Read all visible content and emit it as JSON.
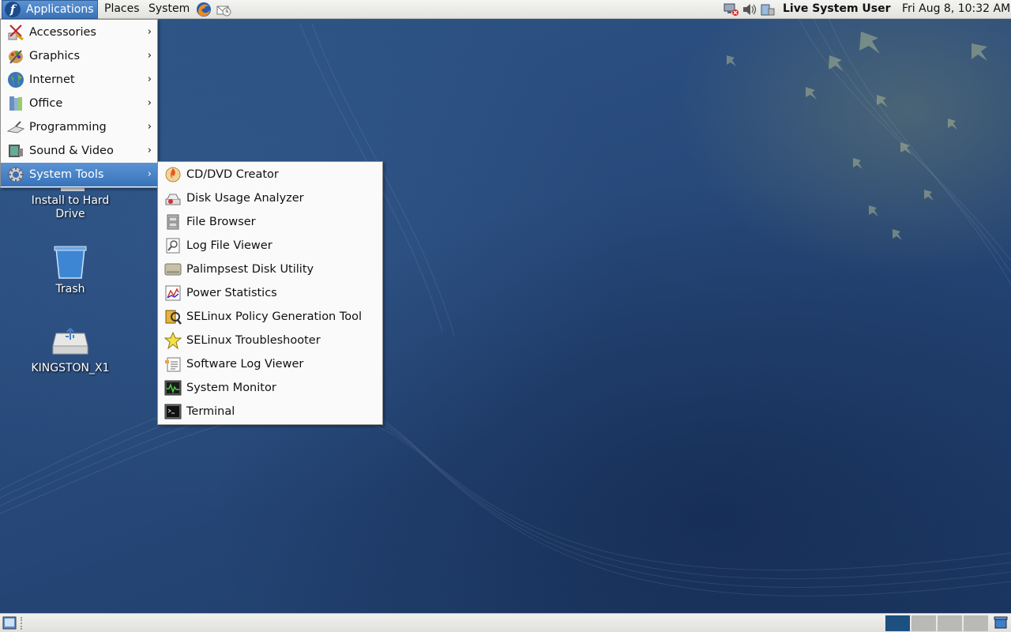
{
  "top_panel": {
    "applications": "Applications",
    "places": "Places",
    "system": "System",
    "user": "Live System User",
    "clock": "Fri Aug  8, 10:32 AM",
    "logo_letter": "f"
  },
  "applications_menu": {
    "items": [
      {
        "label": "Accessories",
        "icon": "accessories-icon"
      },
      {
        "label": "Graphics",
        "icon": "graphics-icon"
      },
      {
        "label": "Internet",
        "icon": "internet-icon"
      },
      {
        "label": "Office",
        "icon": "office-icon"
      },
      {
        "label": "Programming",
        "icon": "programming-icon"
      },
      {
        "label": "Sound & Video",
        "icon": "sound-video-icon"
      },
      {
        "label": "System Tools",
        "icon": "system-tools-icon",
        "active": true
      }
    ],
    "arrow": "›"
  },
  "system_tools_menu": {
    "items": [
      {
        "label": "CD/DVD Creator"
      },
      {
        "label": "Disk Usage Analyzer"
      },
      {
        "label": "File Browser"
      },
      {
        "label": "Log File Viewer"
      },
      {
        "label": "Palimpsest Disk Utility"
      },
      {
        "label": "Power Statistics"
      },
      {
        "label": "SELinux Policy Generation Tool"
      },
      {
        "label": "SELinux Troubleshooter"
      },
      {
        "label": "Software Log Viewer"
      },
      {
        "label": "System Monitor"
      },
      {
        "label": "Terminal"
      }
    ]
  },
  "desktop_icons": [
    {
      "label": "Install to Hard Drive"
    },
    {
      "label": "Trash"
    },
    {
      "label": "KINGSTON_X1"
    }
  ],
  "colors": {
    "menu_highlight": "#3f7cc2",
    "desktop": "#27497a"
  }
}
